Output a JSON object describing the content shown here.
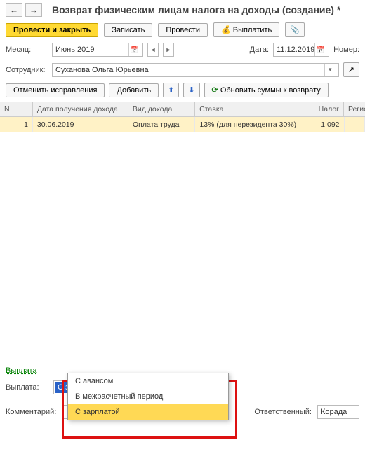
{
  "header": {
    "title": "Возврат физическим лицам налога на доходы (создание) *"
  },
  "toolbar": {
    "post_close": "Провести и закрыть",
    "save": "Записать",
    "post": "Провести",
    "pay": "Выплатить"
  },
  "fields": {
    "month_label": "Месяц:",
    "month_value": "Июнь 2019",
    "date_label": "Дата:",
    "date_value": "11.12.2019",
    "number_label": "Номер:",
    "employee_label": "Сотрудник:",
    "employee_value": "Суханова Ольга Юрьевна"
  },
  "toolbar2": {
    "cancel_fix": "Отменить исправления",
    "add": "Добавить",
    "refresh": "Обновить суммы к возврату"
  },
  "table": {
    "headers": {
      "n": "N",
      "date": "Дата получения дохода",
      "type": "Вид дохода",
      "rate": "Ставка",
      "tax": "Налог",
      "reg": "Регис"
    },
    "rows": [
      {
        "n": "1",
        "date": "30.06.2019",
        "type": "Оплата труда",
        "rate": "13% (для нерезидента 30%)",
        "tax": "1 092"
      }
    ]
  },
  "footer": {
    "payout_link": "Выплата",
    "payout_label": "Выплата:",
    "payout_value": "С зарплатой",
    "comment_label": "Комментарий:",
    "responsible_label": "Ответственный:",
    "responsible_value": "Корада"
  },
  "dropdown": {
    "options": [
      "С авансом",
      "В межрасчетный период",
      "С зарплатой"
    ],
    "selected": 2
  }
}
